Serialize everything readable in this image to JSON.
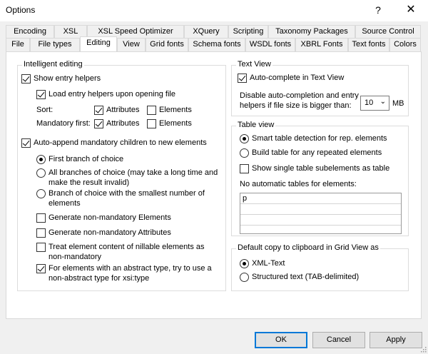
{
  "window": {
    "title": "Options",
    "help_glyph": "?",
    "close_glyph": "✕"
  },
  "tabs_row1": [
    "Encoding",
    "XSL",
    "XSL Speed Optimizer",
    "XQuery",
    "Scripting",
    "Taxonomy Packages",
    "Source Control"
  ],
  "tabs_row2": [
    "File",
    "File types",
    "Editing",
    "View",
    "Grid fonts",
    "Schema fonts",
    "WSDL fonts",
    "XBRL Fonts",
    "Text fonts",
    "Colors"
  ],
  "active_tab": "Editing",
  "intelligent_editing": {
    "title": "Intelligent editing",
    "show_entry_helpers": {
      "label": "Show entry helpers",
      "checked": true
    },
    "load_entry_helpers": {
      "label": "Load entry helpers upon opening file",
      "checked": true
    },
    "sort_label": "Sort:",
    "sort_attributes": {
      "label": "Attributes",
      "checked": true
    },
    "sort_elements": {
      "label": "Elements",
      "checked": false
    },
    "mandatory_label": "Mandatory first:",
    "mandatory_attributes": {
      "label": "Attributes",
      "checked": true
    },
    "mandatory_elements": {
      "label": "Elements",
      "checked": false
    },
    "auto_append": {
      "label": "Auto-append mandatory children to new elements",
      "checked": true
    },
    "radio_first_branch": {
      "label": "First branch of choice",
      "checked": true
    },
    "radio_all_branches": {
      "label": "All branches of choice (may take a long time and make the result invalid)",
      "checked": false
    },
    "radio_smallest_branch": {
      "label": "Branch of choice with the smallest number of elements",
      "checked": false
    },
    "gen_non_mandatory_elements": {
      "label": "Generate non-mandatory Elements",
      "checked": false
    },
    "gen_non_mandatory_attributes": {
      "label": "Generate non-mandatory Attributes",
      "checked": false
    },
    "treat_nillable": {
      "label": "Treat element content of nillable elements as non-mandatory",
      "checked": false
    },
    "abstract_type": {
      "label": "For elements with an abstract type, try to use a non-abstract type  for xsi:type",
      "checked": true
    }
  },
  "text_view": {
    "title": "Text View",
    "auto_complete": {
      "label": "Auto-complete in Text View",
      "checked": true
    },
    "disable_label": "Disable auto-completion and entry helpers if file size is bigger than:",
    "size_value": "10",
    "size_unit": "MB"
  },
  "table_view": {
    "title": "Table view",
    "radio_smart": {
      "label": "Smart table detection for rep. elements",
      "checked": true
    },
    "radio_any": {
      "label": "Build table for any repeated elements",
      "checked": false
    },
    "show_single": {
      "label": "Show single table subelements as table",
      "checked": false
    },
    "no_auto_label": "No automatic tables for elements:",
    "no_auto_items": [
      "p",
      "",
      "",
      ""
    ]
  },
  "clipboard": {
    "title": "Default copy to clipboard in Grid View as",
    "radio_xml": {
      "label": "XML-Text",
      "checked": true
    },
    "radio_structured": {
      "label": "Structured text (TAB-delimited)",
      "checked": false
    }
  },
  "buttons": {
    "ok": "OK",
    "cancel": "Cancel",
    "apply": "Apply"
  }
}
